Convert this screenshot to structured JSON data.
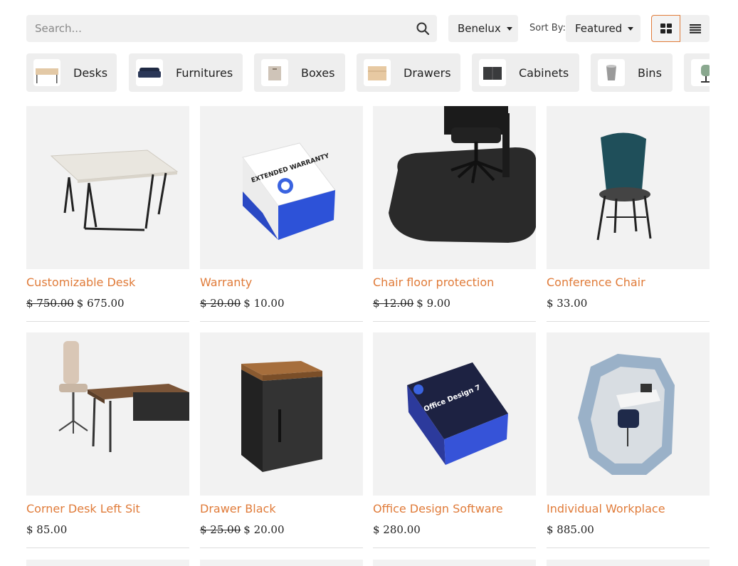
{
  "search": {
    "placeholder": "Search...",
    "value": ""
  },
  "pricelist": {
    "label": "Benelux"
  },
  "sort": {
    "label": "Sort By:",
    "value": "Featured"
  },
  "view_toggle": {
    "grid": "grid-view-icon",
    "list": "list-view-icon",
    "active": "grid"
  },
  "categories": [
    {
      "label": "Desks"
    },
    {
      "label": "Furnitures"
    },
    {
      "label": "Boxes"
    },
    {
      "label": "Drawers"
    },
    {
      "label": "Cabinets"
    },
    {
      "label": "Bins"
    },
    {
      "label": ""
    }
  ],
  "products": [
    {
      "name": "Customizable Desk",
      "old_price": "$ 750.00",
      "price": "$ 675.00"
    },
    {
      "name": "Warranty",
      "old_price": "$ 20.00",
      "price": "$ 10.00",
      "box_text": "EXTENDED WARRANTY"
    },
    {
      "name": "Chair floor protection",
      "old_price": "$ 12.00",
      "price": "$ 9.00"
    },
    {
      "name": "Conference Chair",
      "old_price": "",
      "price": "$ 33.00"
    },
    {
      "name": "Corner Desk Left Sit",
      "old_price": "",
      "price": "$ 85.00"
    },
    {
      "name": "Drawer Black",
      "old_price": "$ 25.00",
      "price": "$ 20.00"
    },
    {
      "name": "Office Design Software",
      "old_price": "",
      "price": "$ 280.00",
      "box_text": "Office Design 7"
    },
    {
      "name": "Individual Workplace",
      "old_price": "",
      "price": "$ 885.00"
    }
  ],
  "colors": {
    "accent": "#e07b39",
    "chip_bg": "#eeeeee",
    "image_bg": "#f2f2f2"
  }
}
